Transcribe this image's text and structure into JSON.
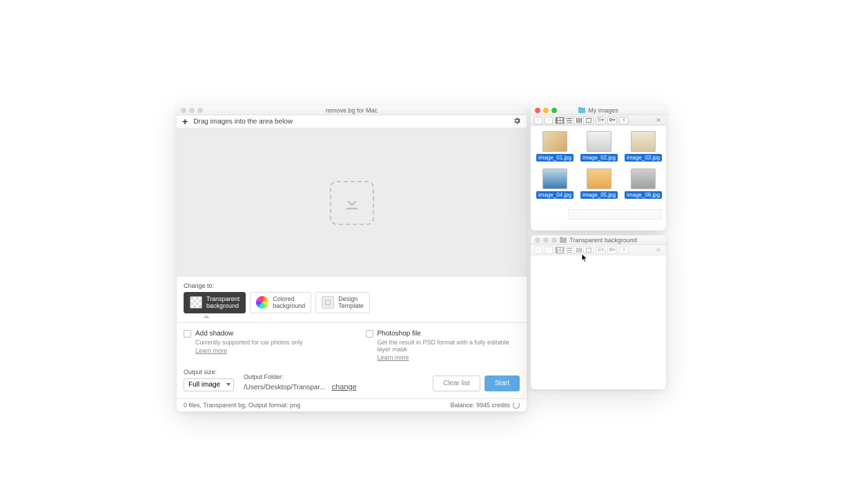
{
  "app": {
    "title": "remove.bg for Mac",
    "dragPrompt": "Drag images into the area below",
    "changeToLabel": "Change to:",
    "options": {
      "transparent": "Transparent\nbackground",
      "colored": "Colored\nbackground",
      "template": "Design\nTemplate"
    },
    "addShadow": {
      "label": "Add shadow",
      "sub": "Currently supported for car photos only",
      "learn": "Learn more"
    },
    "psd": {
      "label": "Photoshop file",
      "sub": "Get the result in PSD format with a fully editable layer mask",
      "learn": "Learn more"
    },
    "outputSizeLabel": "Output size:",
    "outputSizeValue": "Full image",
    "outputFolderLabel": "Output Folder:",
    "outputFolderPath": "/Users/Desktop/Transpar...",
    "changeLink": "change",
    "clearBtn": "Clear list",
    "startBtn": "Start",
    "statusLeft": "0 files, Transparent bg, Output format: png",
    "statusRight": "Balance: 9945 credits"
  },
  "finder1": {
    "title": "My images",
    "files": [
      {
        "name": "image_01.jpg",
        "bg": "linear-gradient(135deg,#e8d9b0,#d9a86c)"
      },
      {
        "name": "image_02.jpg",
        "bg": "linear-gradient(#f2f2f2,#cfcfcf)"
      },
      {
        "name": "image_03.jpg",
        "bg": "linear-gradient(#efe6d4,#d8c8a0)"
      },
      {
        "name": "image_04.jpg",
        "bg": "linear-gradient(#b8d8e8,#3a7db0)"
      },
      {
        "name": "image_05.jpg",
        "bg": "linear-gradient(#f5ce88,#e8a84e)"
      },
      {
        "name": "image_06.jpg",
        "bg": "linear-gradient(#d0d0d0,#a0a0a0)"
      }
    ]
  },
  "finder2": {
    "title": "Transparent background"
  }
}
